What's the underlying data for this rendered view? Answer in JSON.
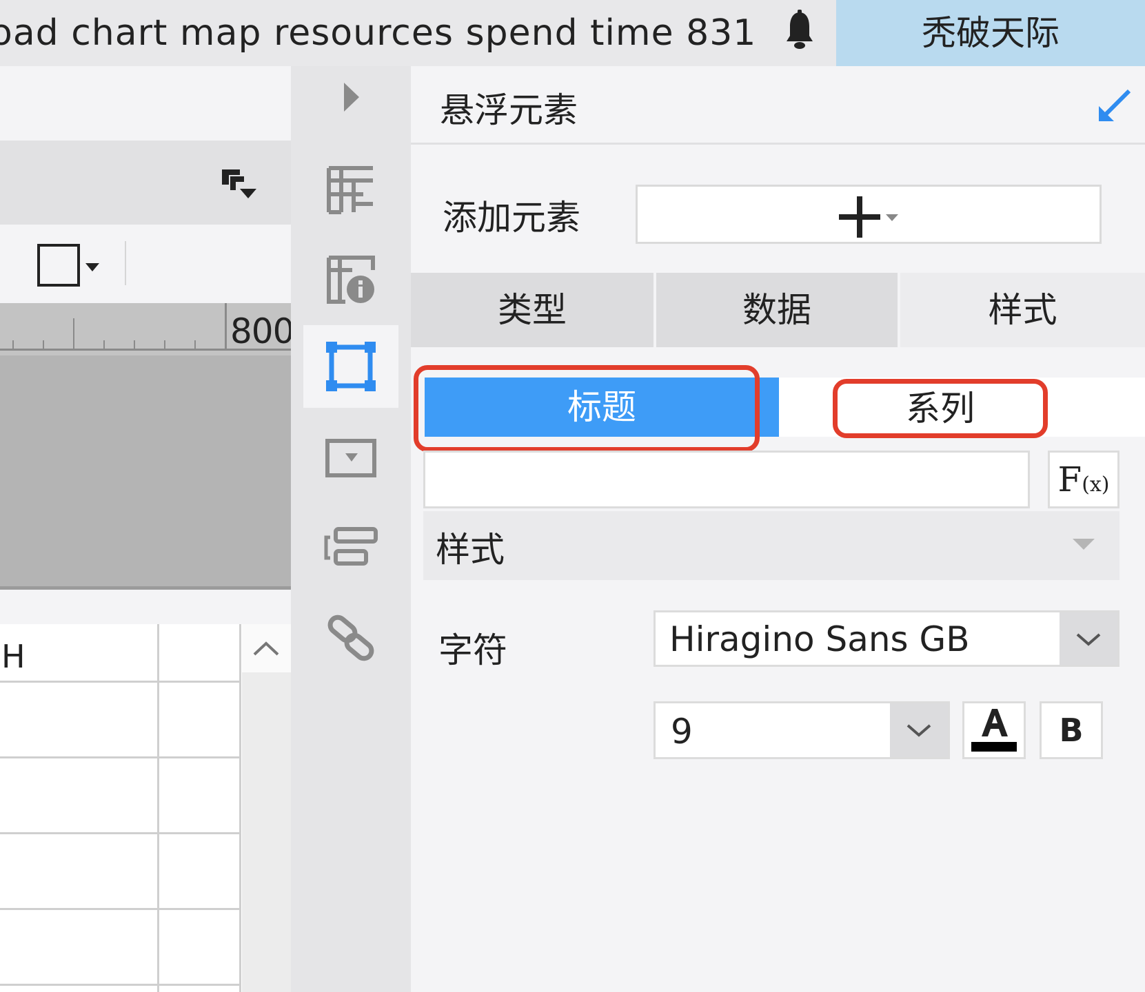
{
  "topbar": {
    "notice": "oad chart map resources spend time 831...",
    "user_name": "秃破天际"
  },
  "editor": {
    "ruler_label": "800",
    "grid_column_header": "H"
  },
  "panel": {
    "title": "悬浮元素",
    "add_element_label": "添加元素",
    "tabs": [
      {
        "label": "类型"
      },
      {
        "label": "数据"
      },
      {
        "label": "样式"
      }
    ],
    "segments": {
      "title_label": "标题",
      "series_label": "系列"
    },
    "fx_label": "F",
    "fx_sub": "(x)",
    "style_section_label": "样式",
    "char_label": "字符",
    "font_family_value": "Hiragino Sans GB",
    "font_size_value": "9",
    "bold_label": "B"
  },
  "colors": {
    "accent_blue": "#3e9cf7",
    "highlight_red": "#e23d2b",
    "user_badge_bg": "#b9daef"
  }
}
